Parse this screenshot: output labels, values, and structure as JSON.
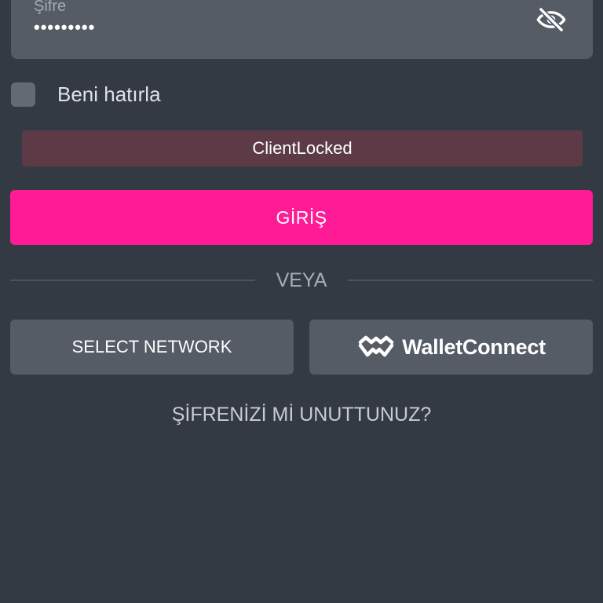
{
  "password_field": {
    "label": "Şifre",
    "value": "•••••••••",
    "toggle_icon": "eye-off-icon"
  },
  "remember_me": {
    "label": "Beni hatırla",
    "checked": false
  },
  "error": {
    "message": "ClientLocked"
  },
  "login_button": {
    "label": "GİRİŞ"
  },
  "divider": {
    "label": "VEYA"
  },
  "alt_login": {
    "select_network_label": "SELECT NETWORK",
    "wallet_connect_label": "WalletConnect",
    "wallet_connect_icon": "walletconnect-logo-icon"
  },
  "forgot_password": {
    "label": "ŞİFRENİZİ Mİ UNUTTUNUZ?"
  },
  "colors": {
    "background": "#343a44",
    "field": "#555c65",
    "primary": "#ff1a96",
    "error_bg": "#5c3b46"
  }
}
